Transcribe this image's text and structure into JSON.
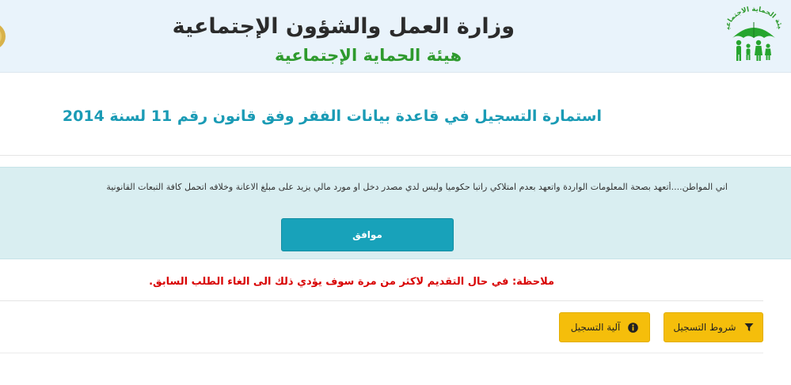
{
  "header": {
    "ministry_title": "وزارة العمل والشؤون الإجتماعية",
    "authority_title": "هيئة الحماية الإجتماعية",
    "logo_text": "هيئة الحماية الاجتماعية",
    "logo_icon": "family-umbrella-logo",
    "left_emblem_icon": "gold-emblem"
  },
  "form": {
    "title": "استمارة التسجيل في قاعدة بيانات الفقر وفق قانون رقم 11 لسنة 2014"
  },
  "pledge": {
    "text": "اني المواطن....أتعهد بصحة المعلومات الواردة واتعهد بعدم امتلاكي راتبا حكوميا وليس لدي مصدر دخل او مورد مالي يزيد على مبلغ الاعانة وخلافه اتحمل كافة التبعات القانونية",
    "agree_label": "موافق"
  },
  "note": {
    "text": "ملاحظة: في حال التقديم لاكثر من مرة سوف يؤدي ذلك الى الغاء الطلب السابق."
  },
  "actions": {
    "conditions_label": "شروط التسجيل",
    "conditions_icon": "filter-icon",
    "mechanism_label": "آلية التسجيل",
    "mechanism_icon": "info-icon"
  },
  "colors": {
    "header_bg": "#e9f3fb",
    "title_teal": "#1a9bb5",
    "authority_green": "#2e9a2e",
    "pledge_bg": "#d9eef1",
    "agree_button": "#18a2ba",
    "note_red": "#d80000",
    "action_yellow": "#f5be0b"
  }
}
